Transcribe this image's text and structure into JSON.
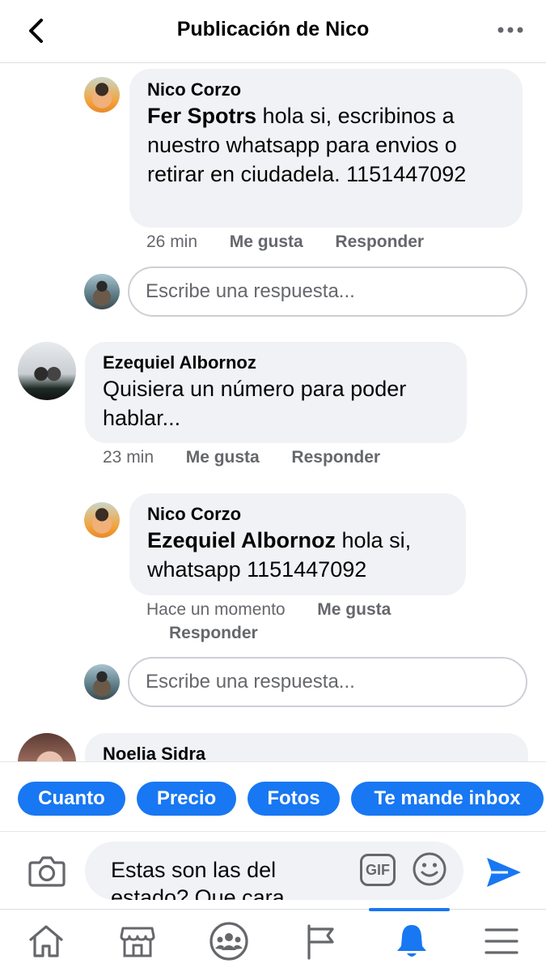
{
  "header": {
    "title": "Publicación de Nico"
  },
  "comments": [
    {
      "author": "Nico Corzo",
      "mention": "Fer Spotrs",
      "text": "hola si, escribinos a nuestro whatsapp para envios o retirar en ciudadela. 1151447092",
      "time": "26 min",
      "like": "Me gusta",
      "reply": "Responder"
    },
    {
      "author": "Ezequiel Albornoz",
      "text": "Quisiera un número para poder hablar...",
      "time": "23 min",
      "like": "Me gusta",
      "reply": "Responder"
    },
    {
      "author": "Nico Corzo",
      "mention": "Ezequiel Albornoz",
      "text": "hola si, whatsapp 1151447092",
      "time": "Hace un momento",
      "like": "Me gusta",
      "reply": "Responder"
    },
    {
      "author": "Noelia Sidra"
    }
  ],
  "reply_placeholder": "Escribe una respuesta...",
  "quick_replies": [
    "Cuanto",
    "Precio",
    "Fotos",
    "Te mande inbox"
  ],
  "composer": {
    "text": "Estas son las del estado? Que cara"
  },
  "composer_gif": "GIF",
  "tabs": [
    {
      "icon": "home-icon"
    },
    {
      "icon": "marketplace-icon"
    },
    {
      "icon": "groups-icon"
    },
    {
      "icon": "pages-flag-icon"
    },
    {
      "icon": "notifications-bell-icon",
      "active": true
    },
    {
      "icon": "menu-icon"
    }
  ],
  "colors": {
    "accent": "#1877f2",
    "bubble": "#f0f2f5",
    "meta": "#65676b"
  }
}
